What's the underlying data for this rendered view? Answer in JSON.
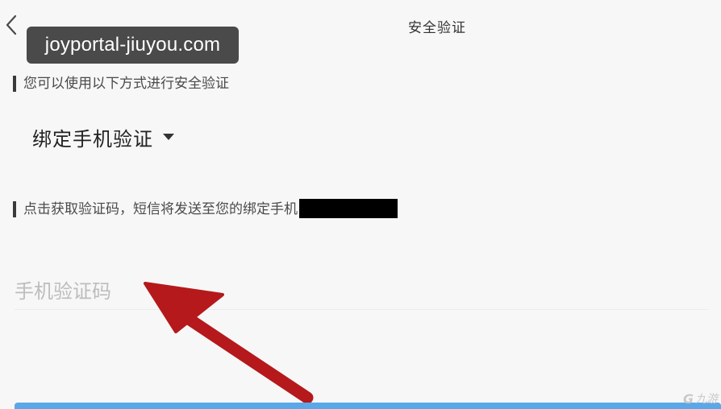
{
  "header": {
    "title": "安全验证"
  },
  "watermark": {
    "text": "joyportal-jiuyou.com"
  },
  "sections": {
    "method_hint": "您可以使用以下方式进行安全验证",
    "method_selected": "绑定手机验证",
    "sms_hint": "点击获取验证码，短信将发送至您的绑定手机"
  },
  "code_input": {
    "placeholder": "手机验证码",
    "value": ""
  },
  "corner_logo": {
    "mark": "G",
    "text": "九游"
  },
  "colors": {
    "background": "#f7f7f7",
    "annotation_arrow": "#b5191b",
    "primary_button": "#5aa8e8"
  },
  "icons": {
    "back": "chevron-left-icon",
    "dropdown": "caret-down-icon",
    "annotation": "red-arrow-icon"
  }
}
